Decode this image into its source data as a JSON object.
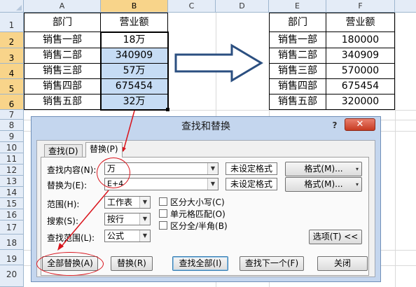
{
  "sheet": {
    "columns": [
      "A",
      "B",
      "C",
      "D",
      "E",
      "F"
    ],
    "rows": [
      "1",
      "2",
      "3",
      "4",
      "5",
      "6",
      "7",
      "8",
      "9",
      "10",
      "11",
      "12",
      "13",
      "14",
      "15",
      "16",
      "17",
      "18",
      "19",
      "20"
    ],
    "left_table": {
      "headers": [
        "部门",
        "营业额"
      ],
      "rows": [
        [
          "销售一部",
          "18万"
        ],
        [
          "销售二部",
          "340909"
        ],
        [
          "销售三部",
          "57万"
        ],
        [
          "销售四部",
          "675454"
        ],
        [
          "销售五部",
          "32万"
        ]
      ]
    },
    "right_table": {
      "headers": [
        "部门",
        "营业额"
      ],
      "rows": [
        [
          "销售一部",
          "180000"
        ],
        [
          "销售二部",
          "340909"
        ],
        [
          "销售三部",
          "570000"
        ],
        [
          "销售四部",
          "675454"
        ],
        [
          "销售五部",
          "320000"
        ]
      ]
    }
  },
  "dialog": {
    "title": "查找和替换",
    "help": "?",
    "close": "✕",
    "tabs": [
      "查找(D)",
      "替换(P)"
    ],
    "find_label": "查找内容(N):",
    "find_value": "万",
    "replace_label": "替换为(E):",
    "replace_value": "E+4",
    "no_format_1": "未设定格式",
    "no_format_2": "未设定格式",
    "format_btn_1": "格式(M)...",
    "format_btn_2": "格式(M)...",
    "scope_label": "范围(H):",
    "scope_value": "工作表",
    "search_label": "搜索(S):",
    "search_value": "按行",
    "lookin_label": "查找范围(L):",
    "lookin_value": "公式",
    "match_case": "区分大小写(C)",
    "match_entire": "单元格匹配(O)",
    "match_byte": "区分全/半角(B)",
    "options_btn": "选项(T) <<",
    "replace_all_btn": "全部替换(A)",
    "replace_btn": "替换(R)",
    "find_all_btn": "查找全部(I)",
    "find_next_btn": "查找下一个(F)",
    "close_btn": "关闭"
  },
  "colors": {
    "highlight_cell": "#c6dcf4",
    "annotation": "#d9141c",
    "dialog_frame": "#c4d6ee"
  }
}
